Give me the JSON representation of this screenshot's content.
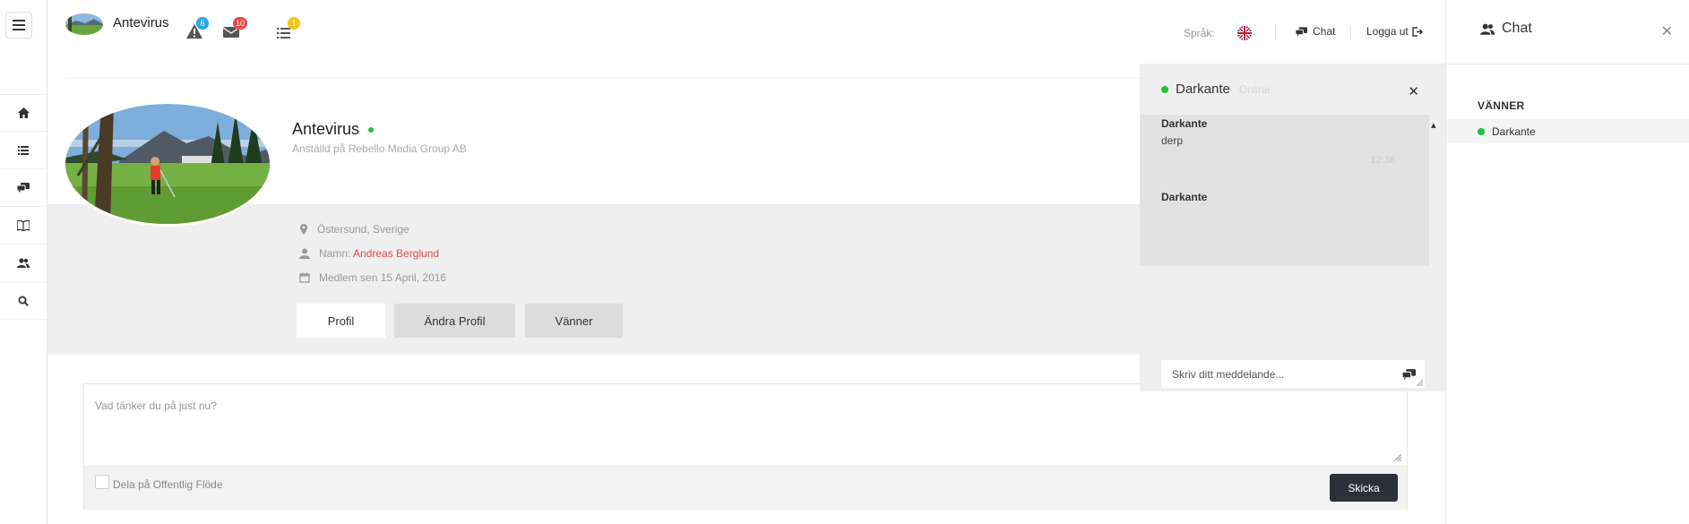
{
  "brand": {
    "name": "Antevirus"
  },
  "notifications": [
    {
      "icon": "warning-icon",
      "count": "6",
      "color": "#27a9e1"
    },
    {
      "icon": "mail-icon",
      "count": "10",
      "color": "#e34a4a"
    },
    {
      "icon": "list-icon",
      "count": "1",
      "color": "#f7c61a"
    }
  ],
  "header": {
    "language_label": "Språk:",
    "chat_label": "Chat",
    "logout_label": "Logga ut"
  },
  "sidebar": {
    "items": [
      {
        "icon": "home-icon"
      },
      {
        "icon": "list-icon"
      },
      {
        "icon": "chat-icon"
      },
      {
        "icon": "book-icon"
      },
      {
        "icon": "users-icon"
      },
      {
        "icon": "search-icon"
      }
    ]
  },
  "profile": {
    "name": "Antevirus",
    "subtitle": "Anställd på Rebello Media Group AB",
    "location": "Östersund, Sverige",
    "name_label": "Namn:",
    "full_name": "Andreas Berglund",
    "member_since": "Medlem sen 15 April, 2016",
    "buttons": [
      "Profil",
      "Ändra Profil",
      "Vänner"
    ]
  },
  "post": {
    "placeholder": "Vad tänker du på just nu?",
    "share_label": "Dela på Offentlig Flöde",
    "submit_label": "Skicka"
  },
  "chat_window": {
    "contact": "Darkante",
    "status": "Online",
    "messages": [
      {
        "from": "Darkante",
        "text": "derp",
        "time": "12:38"
      },
      {
        "from": "Darkante"
      }
    ],
    "input_placeholder": "Skriv ditt meddelande..."
  },
  "chat_panel": {
    "title": "Chat",
    "section": "VÄNNER",
    "friends": [
      "Darkante"
    ]
  },
  "colors": {
    "accent": "#e34a4a",
    "online": "#1ec13c",
    "dark_button": "#2b313b"
  }
}
